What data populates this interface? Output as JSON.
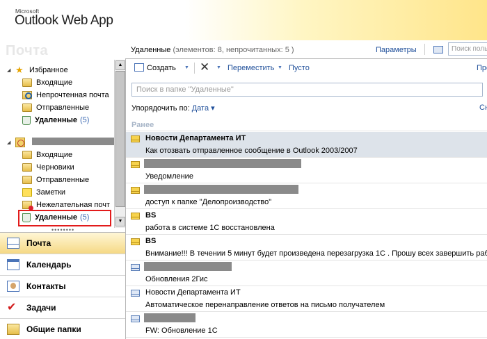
{
  "brand": {
    "company": "Microsoft",
    "app": "Outlook Web App"
  },
  "left": {
    "module_title": "Почта",
    "favorites": {
      "label": "Избранное",
      "items": [
        {
          "label": "Входящие"
        },
        {
          "label": "Непрочтенная почта"
        },
        {
          "label": "Отправленные"
        },
        {
          "label": "Удаленные",
          "count": "(5)"
        }
      ]
    },
    "mailbox": {
      "items": [
        {
          "label": "Входящие"
        },
        {
          "label": "Черновики"
        },
        {
          "label": "Отправленные"
        },
        {
          "label": "Заметки"
        },
        {
          "label": "Нежелательная почт"
        },
        {
          "label": "Удаленные",
          "count": "(5)"
        }
      ]
    },
    "nav": [
      {
        "label": "Почта",
        "icon": "mail-icon",
        "active": true
      },
      {
        "label": "Календарь",
        "icon": "calendar-icon"
      },
      {
        "label": "Контакты",
        "icon": "contacts-icon"
      },
      {
        "label": "Задачи",
        "icon": "tasks-icon"
      },
      {
        "label": "Общие папки",
        "icon": "public-folders-icon"
      }
    ]
  },
  "right": {
    "folder_name": "Удаленные",
    "folder_stats": "(элементов: 8, непрочитанных: 5 )",
    "options_label": "Параметры",
    "top_search_placeholder": "Поиск поль",
    "toolbar": {
      "create": "Создать",
      "move": "Переместить",
      "empty": "Пусто",
      "more": "Пре"
    },
    "folder_search_placeholder": "Поиск в папке \"Удаленные\"",
    "sort": {
      "label": "Упорядочить по:",
      "value": "Дата",
      "right": "Сн"
    },
    "group_label": "Ранее",
    "messages": [
      {
        "sender": "Новости Департамента ИТ",
        "subject": "Как отозвать отправленное сообщение в Outlook 2003/2007",
        "unread": true,
        "selected": true
      },
      {
        "sender": "",
        "subject": "Уведомление",
        "unread": true
      },
      {
        "sender": "",
        "subject": "доступ к папке \"Делопроизводство\"",
        "unread": true
      },
      {
        "sender": "BS",
        "subject": "работа в системе 1С восстановлена",
        "unread": true
      },
      {
        "sender": "BS",
        "subject": "Внимание!!! В течении 5 минут будет произведена перезагрузка 1С . Прошу всех завершить работу",
        "unread": true
      },
      {
        "sender": "",
        "subject": "Обновления 2Гис",
        "unread": false
      },
      {
        "sender": "Новости Департамента ИТ",
        "subject": "Автоматическое перенаправление ответов на письмо получателем",
        "unread": false
      },
      {
        "sender": "",
        "subject": "FW: Обновление 1С",
        "unread": false
      }
    ]
  }
}
